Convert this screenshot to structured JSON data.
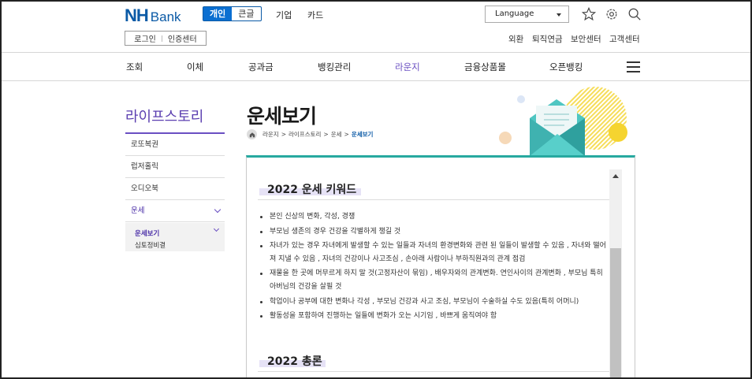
{
  "header": {
    "logo_nh": "NH",
    "logo_bank": "Bank",
    "segments": [
      "개인",
      "큰글"
    ],
    "menu": [
      "기업",
      "카드"
    ],
    "language_label": "Language",
    "login": "로그인",
    "cert": "인증센터",
    "util_links": [
      "외환",
      "퇴직연금",
      "보안센터",
      "고객센터"
    ]
  },
  "nav": {
    "items": [
      "조회",
      "이체",
      "공과금",
      "뱅킹관리",
      "라운지",
      "금융상품몰",
      "오픈뱅킹"
    ],
    "active": "라운지"
  },
  "sidebar": {
    "title": "라이프스토리",
    "items": [
      "로또복권",
      "럽저홀릭",
      "오디오북",
      "운세"
    ],
    "sub_items": [
      "운세보기",
      "심토정비결"
    ]
  },
  "page": {
    "title": "운세보기",
    "breadcrumb": [
      "라운지",
      "라이프스토리",
      "운세",
      "운세보기"
    ]
  },
  "content": {
    "section1_title": "2022 운세 키워드",
    "bullets": [
      "본인 신상의 변화, 각성, 경쟁",
      "부모님 생존의 경우 건강을 각별하게 챙길 것",
      "자녀가 있는 경우 자녀에게 발생할 수 있는 일들과 자녀의 환경변화와 관련 된 일들이 발생할 수 있음 , 자녀와 떨어져 지낼 수 있음 , 자녀의 건강이나 사고조심 , 손아래 사람이나 부하직원과의 관계 점검",
      "재물을 한 곳에 머무르게 하지 말 것(고정자산이 묶임) , 배우자와의 관계변화. 연인사이의 관계변화 , 부모님 특히 아버님의 건강을 살필 것",
      "학업이나 공부에 대한 변화나 각성 , 부모님 건강과 사고 조심, 부모님이 수술하실 수도 있음(특히 어머니)",
      "활동성을 포함하여 진행하는 일들에 변화가 오는 시기임 , 바쁘게 움직여야 함"
    ],
    "section2_title": "2022 총론"
  },
  "colors": {
    "brand_blue": "#0b5aa6",
    "accent_purple": "#6a4fc2",
    "panel_teal": "#27a9a0"
  }
}
